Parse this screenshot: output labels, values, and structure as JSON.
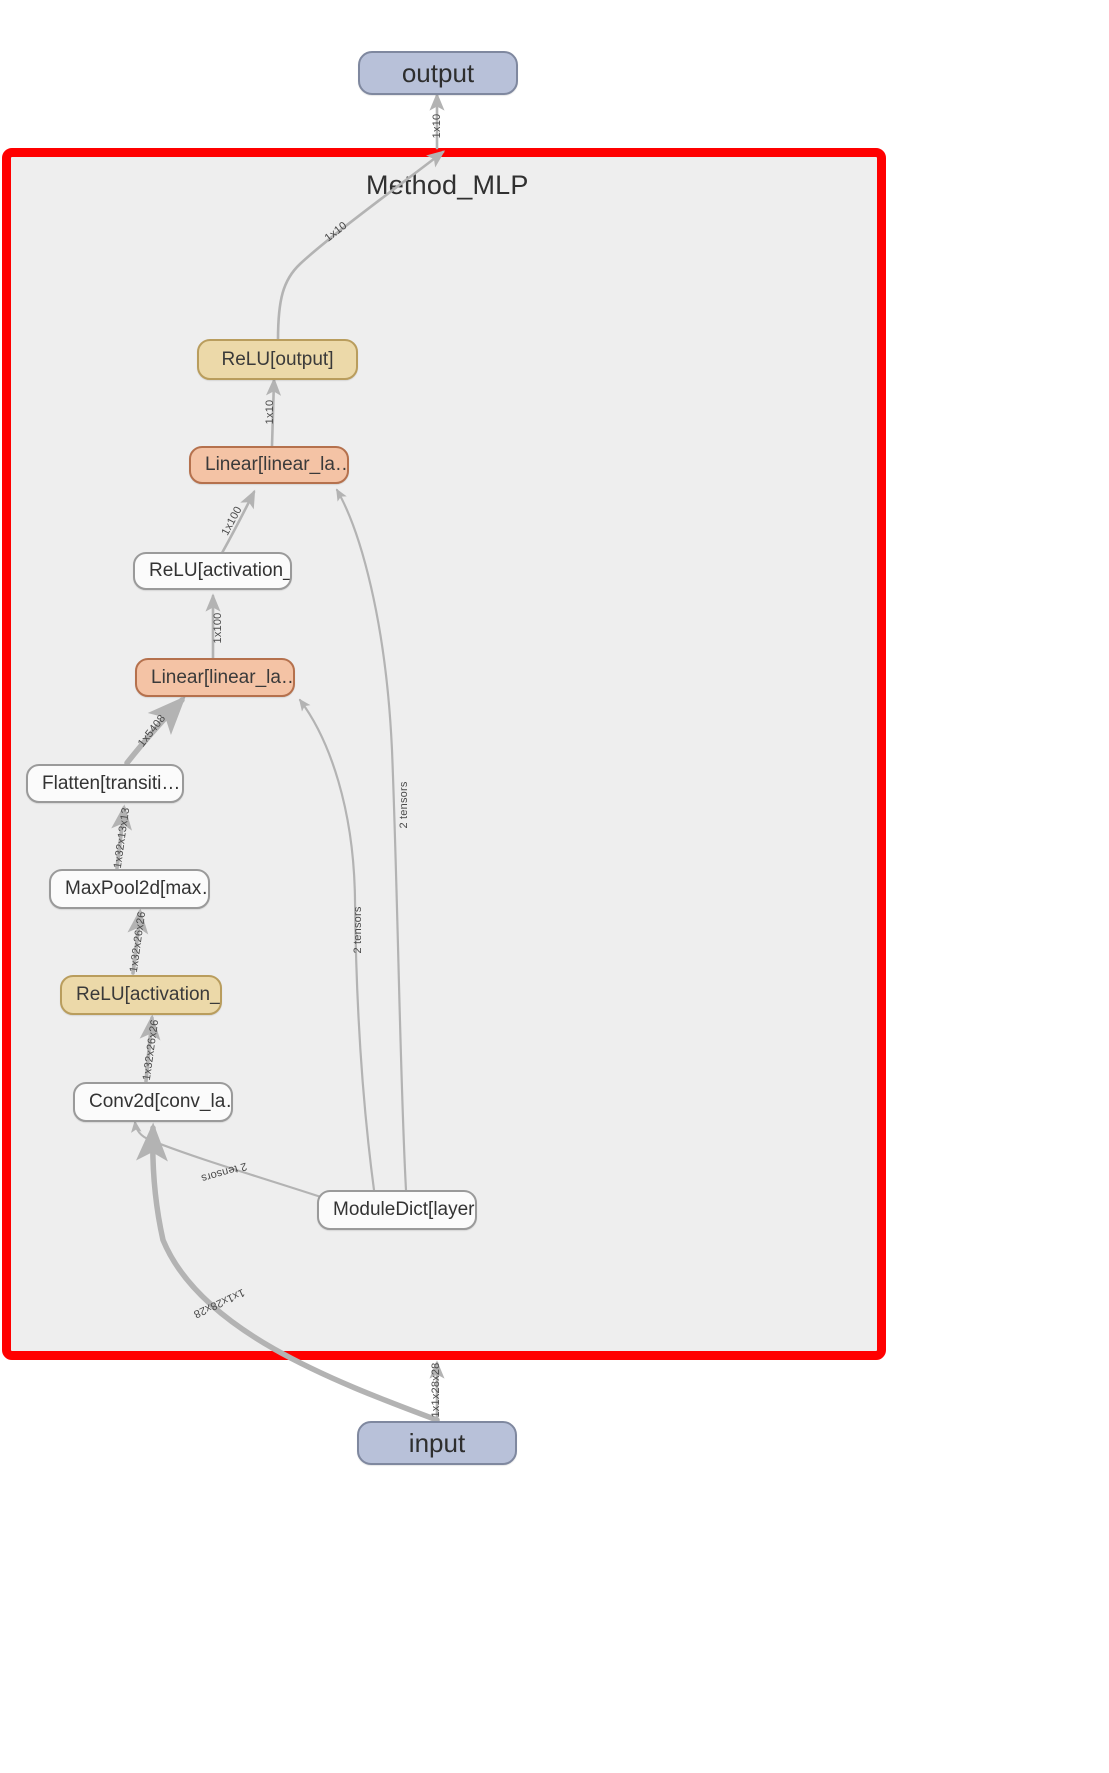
{
  "graph": {
    "title": "Method_MLP",
    "highlight_color": "#ff0000",
    "cluster_background": "#eeeeee",
    "io_node_color": "#b8c1d9",
    "tan_node_color": "#ecd9a9",
    "salmon_node_color": "#f4c3a5",
    "plain_node_color": "#fbfbfb",
    "edge_color": "#b0b0b0"
  },
  "nodes": {
    "output": "output",
    "relu_output": "ReLU[output]",
    "linear_2": "Linear[linear_la…",
    "relu_activation_2": "ReLU[activation_…",
    "linear_1": "Linear[linear_la…",
    "flatten": "Flatten[transiti…",
    "maxpool": "MaxPool2d[max…",
    "relu_activation_1": "ReLU[activation_…",
    "conv2d": "Conv2d[conv_la…",
    "moduledict": "ModuleDict[layers]",
    "input": "input"
  },
  "edge_labels": {
    "output_top": "1x10",
    "relu_out_to_boundary": "1x10",
    "linear2_to_relu_out": "1x10",
    "relu_act2_to_linear2": "1x100",
    "linear1_to_relu_act2": "1x100",
    "flatten_to_linear1": "1x5408",
    "maxpool_to_flatten": "1x32x13x13",
    "relu_act1_to_maxpool": "1x32x26x26",
    "conv_to_relu_act1": "1x32x26x26",
    "input_to_conv": "1x1x28x28",
    "moduledict_to_conv": "2 tensors",
    "moduledict_to_linear1": "2 tensors",
    "moduledict_to_linear2": "2 tensors"
  }
}
